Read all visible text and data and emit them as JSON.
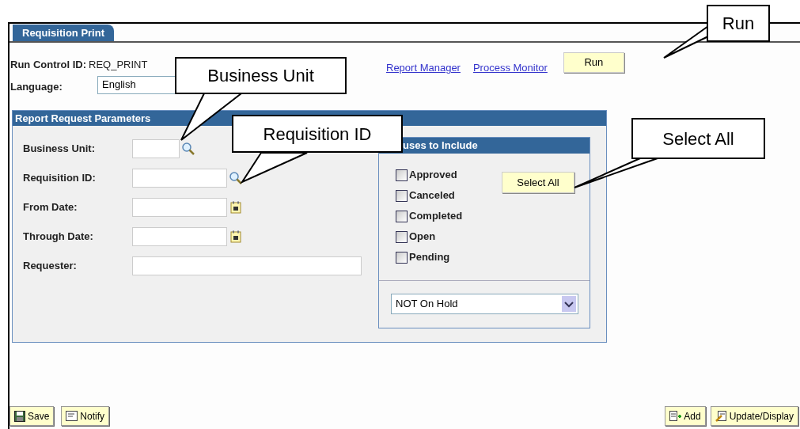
{
  "page_tab": {
    "label": "Requisition Print",
    "selected": true
  },
  "run_control": {
    "label": "Run Control ID:",
    "value": "REQ_PRINT"
  },
  "language": {
    "label": "Language:",
    "value": "English"
  },
  "links": [
    "Report Manager",
    "Process Monitor"
  ],
  "run_button": "Run",
  "parameters": {
    "title": "Report Request Parameters",
    "fields": [
      {
        "label": "Business Unit:",
        "kind": "unit_lookup"
      },
      {
        "label": "Requisition ID:",
        "kind": "lookup"
      },
      {
        "label": "From Date:",
        "kind": "date"
      },
      {
        "label": "Through Date:",
        "kind": "date"
      },
      {
        "label": "Requester:",
        "kind": "text"
      }
    ]
  },
  "statuses": {
    "title": "uses to Include",
    "items": [
      {
        "label": "Approved",
        "checked": false
      },
      {
        "label": "Canceled",
        "checked": false
      },
      {
        "label": "Completed",
        "checked": false
      },
      {
        "label": "Open",
        "checked": false
      },
      {
        "label": "Pending",
        "checked": false
      }
    ],
    "select_all": "Select All",
    "hold_filter": "NOT On Hold"
  },
  "footer_left": [
    {
      "label": "Save",
      "kind": "save"
    },
    {
      "label": "Notify",
      "kind": "notify"
    }
  ],
  "footer_right": [
    {
      "label": "Add",
      "kind": "add"
    },
    {
      "label": "Update/Display",
      "kind": "update"
    }
  ],
  "callouts": [
    "Business Unit",
    "Requisition ID",
    "Run",
    "Select All"
  ]
}
